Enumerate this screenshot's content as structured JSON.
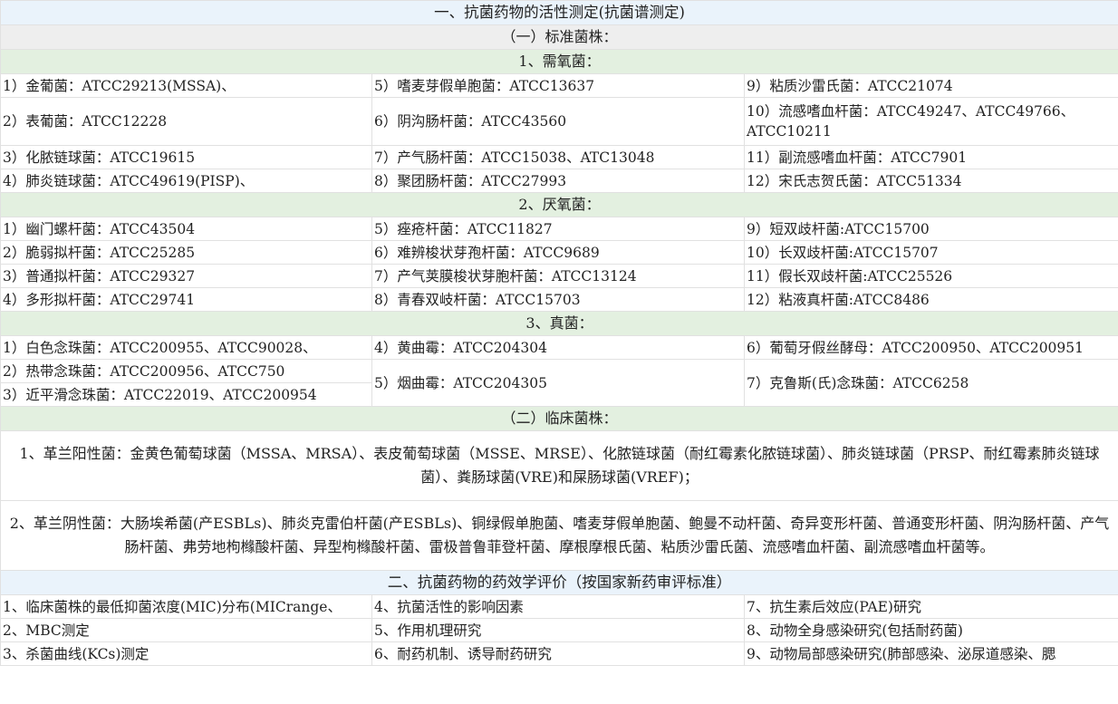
{
  "sections": {
    "s1_title": "一、抗菌药物的活性测定(抗菌谱测定)",
    "s1_sub1": "（一）标准菌株：",
    "cat_aerobic": "1、需氧菌：",
    "aerobic_rows": [
      [
        "1）金葡菌：ATCC29213(MSSA)、",
        "5）嗜麦芽假单胞菌：ATCC13637",
        "9）粘质沙雷氏菌：ATCC21074"
      ],
      [
        "2）表葡菌：ATCC12228",
        "6）阴沟肠杆菌：ATCC43560",
        "10）流感嗜血杆菌：ATCC49247、ATCC49766、ATCC10211"
      ],
      [
        "3）化脓链球菌：ATCC19615",
        "7）产气肠杆菌：ATCC15038、ATC13048",
        "11）副流感嗜血杆菌：ATCC7901"
      ],
      [
        "4）肺炎链球菌：ATCC49619(PISP)、",
        "8）聚团肠杆菌：ATCC27993",
        "12）宋氏志贺氏菌：ATCC51334"
      ]
    ],
    "cat_anaerobic": "2、厌氧菌：",
    "anaerobic_rows": [
      [
        "1）幽门螺杆菌：ATCC43504",
        "5）痤疮杆菌：ATCC11827",
        "9）短双歧杆菌:ATCC15700"
      ],
      [
        "2）脆弱拟杆菌：ATCC25285",
        "6）难辨梭状芽孢杆菌：ATCC9689",
        "10）长双歧杆菌:ATCC15707"
      ],
      [
        "3）普通拟杆菌：ATCC29327",
        "7）产气荚膜梭状芽胞杆菌：ATCC13124",
        "11）假长双歧杆菌:ATCC25526"
      ],
      [
        "4）多形拟杆菌：ATCC29741",
        "8）青春双岐杆菌：ATCC15703",
        "12）粘液真杆菌:ATCC8486"
      ]
    ],
    "cat_fungi": "3、真菌：",
    "fungi": {
      "c1": [
        "1）白色念珠菌：ATCC200955、ATCC90028、",
        "2）热带念珠菌：ATCC200956、ATCC750",
        "3）近平滑念珠菌：ATCC22019、ATCC200954"
      ],
      "c2": [
        "4）黄曲霉：ATCC204304",
        "5）烟曲霉：ATCC204305"
      ],
      "c3": [
        "6）葡萄牙假丝酵母：ATCC200950、ATCC200951",
        "7）克鲁斯(氏)念珠菌：ATCC6258"
      ]
    },
    "s1_sub2": "（二）临床菌株：",
    "clinical_1": "1、革兰阳性菌：金黄色葡萄球菌（MSSA、MRSA）、表皮葡萄球菌（MSSE、MRSE）、化脓链球菌（耐红霉素化脓链球菌）、肺炎链球菌（PRSP、耐红霉素肺炎链球菌）、粪肠球菌(VRE)和屎肠球菌(VREF)；",
    "clinical_2": "2、革兰阴性菌：大肠埃希菌(产ESBLs)、肺炎克雷伯杆菌(产ESBLs)、铜绿假单胞菌、嗜麦芽假单胞菌、鲍曼不动杆菌、奇异变形杆菌、普通变形杆菌、阴沟肠杆菌、产气肠杆菌、弗劳地枸橼酸杆菌、异型枸橼酸杆菌、雷极普鲁菲登杆菌、摩根摩根氏菌、粘质沙雷氏菌、流感嗜血杆菌、副流感嗜血杆菌等。",
    "s2_title": "二、抗菌药物的药效学评价（按国家新药审评标准）",
    "s2_rows": [
      [
        "1、临床菌株的最低抑菌浓度(MIC)分布(MICrange、",
        "4、抗菌活性的影响因素",
        "7、抗生素后效应(PAE)研究"
      ],
      [
        "2、MBC测定",
        "5、作用机理研究",
        "8、动物全身感染研究(包括耐药菌)"
      ],
      [
        "3、杀菌曲线(KCs)测定",
        "6、耐药机制、诱导耐药研究",
        "9、动物局部感染研究(肺部感染、泌尿道感染、腮"
      ]
    ]
  }
}
